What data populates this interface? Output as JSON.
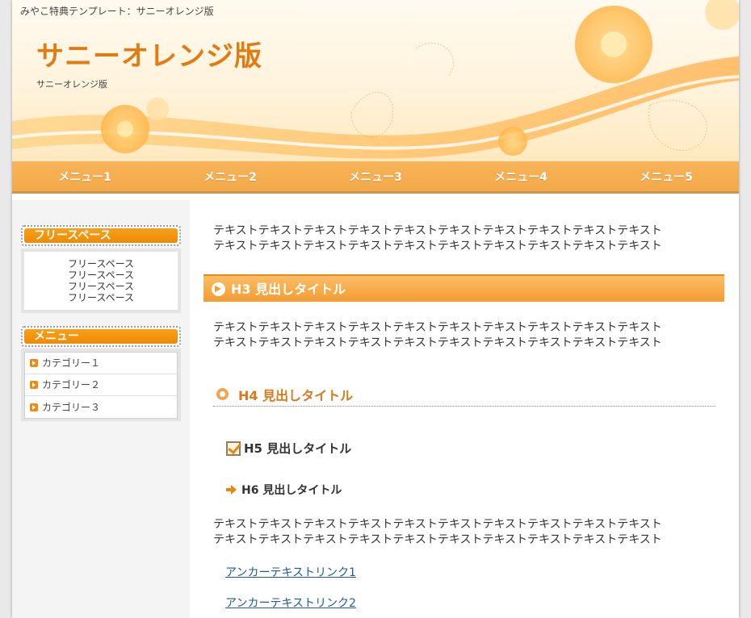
{
  "header": {
    "tagline": "みやこ特典テンプレート：サニーオレンジ版",
    "title": "サニーオレンジ版",
    "subtitle": "サニーオレンジ版"
  },
  "nav": {
    "items": [
      "メニュー1",
      "メニュー2",
      "メニュー3",
      "メニュー4",
      "メニュー5"
    ]
  },
  "sidebar": {
    "free_space_heading": "フリースペース",
    "free_space_lines": [
      "フリースペース",
      "フリースペース",
      "フリースペース",
      "フリースペース"
    ],
    "menu_heading": "メニュー",
    "menu_items": [
      "カテゴリー１",
      "カテゴリー２",
      "カテゴリー３"
    ]
  },
  "main": {
    "para1": [
      "テキストテキストテキストテキストテキストテキストテキストテキストテキストテキスト",
      "テキストテキストテキストテキストテキストテキストテキストテキストテキストテキスト"
    ],
    "h3": "H3 見出しタイトル",
    "para2": [
      "テキストテキストテキストテキストテキストテキストテキストテキストテキストテキスト",
      "テキストテキストテキストテキストテキストテキストテキストテキストテキストテキスト"
    ],
    "h4": "H4 見出しタイトル",
    "h5": "H5 見出しタイトル",
    "h6": "H6 見出しタイトル",
    "para3": [
      "テキストテキストテキストテキストテキストテキストテキストテキストテキストテキスト",
      "テキストテキストテキストテキストテキストテキストテキストテキストテキストテキスト"
    ],
    "link1": "アンカーテキストリンク1",
    "link2": "アンカーテキストリンク2"
  },
  "colors": {
    "accent": "#f3a94a",
    "title": "#e07c12",
    "link": "#1e5a9e",
    "heading_bar": "#ef8a06"
  }
}
